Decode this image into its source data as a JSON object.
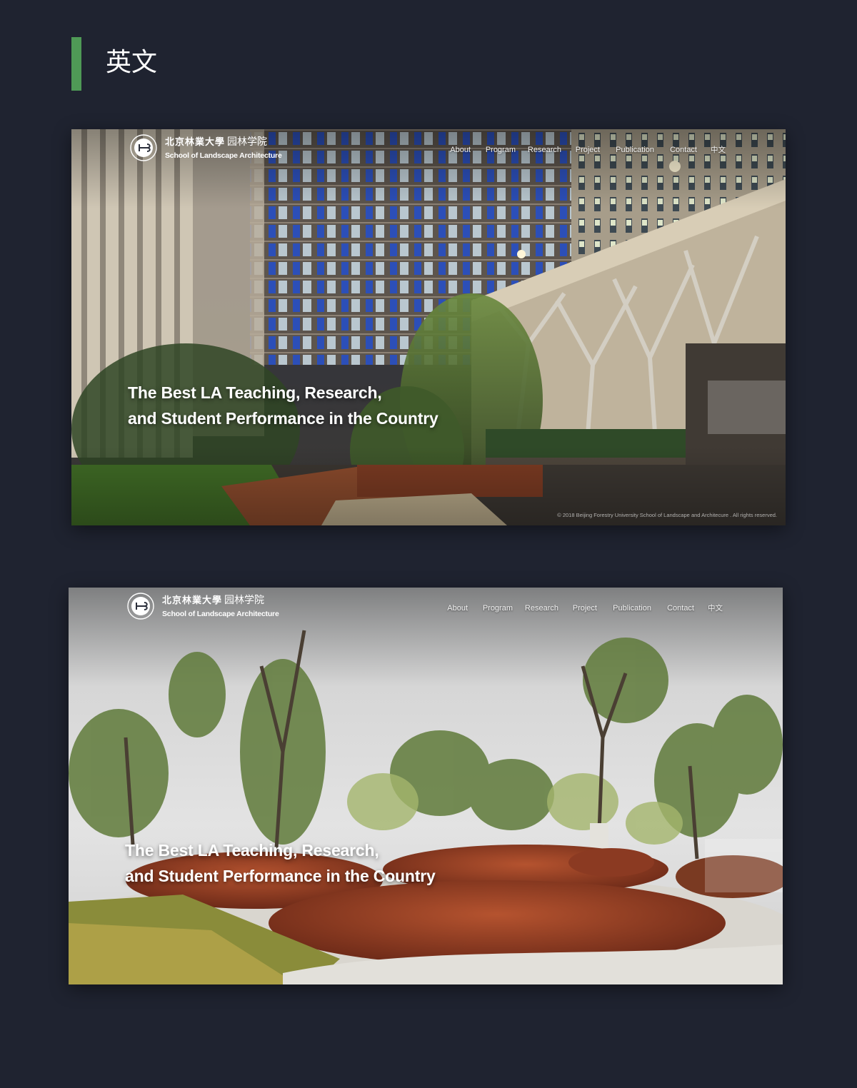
{
  "page": {
    "section_title": "英文",
    "accent_color": "#4f9a56",
    "background_color": "#1f2330"
  },
  "site": {
    "logo_icon": "university-seal-icon",
    "logo_name_cn": "北京林業大學",
    "logo_school_cn": "园林学院",
    "logo_name_en": "School of Landscape Architecture",
    "nav": [
      "About",
      "Program",
      "Research",
      "Project",
      "Publication",
      "Contact"
    ],
    "language_switch": "中文",
    "hero_line1": "The Best LA Teaching, Research,",
    "hero_line2": "and Student Performance in the Country",
    "copyright": "© 2018   Beijing Forestry University School of Landscape and Architecure . All rights reserved."
  },
  "screens": [
    {
      "name": "night-courtyard-homepage",
      "background": "night campus courtyard with bamboo and tree-shaped columns"
    },
    {
      "name": "garden-homepage",
      "background": "landscaped garden with trees and red shrubs"
    }
  ]
}
